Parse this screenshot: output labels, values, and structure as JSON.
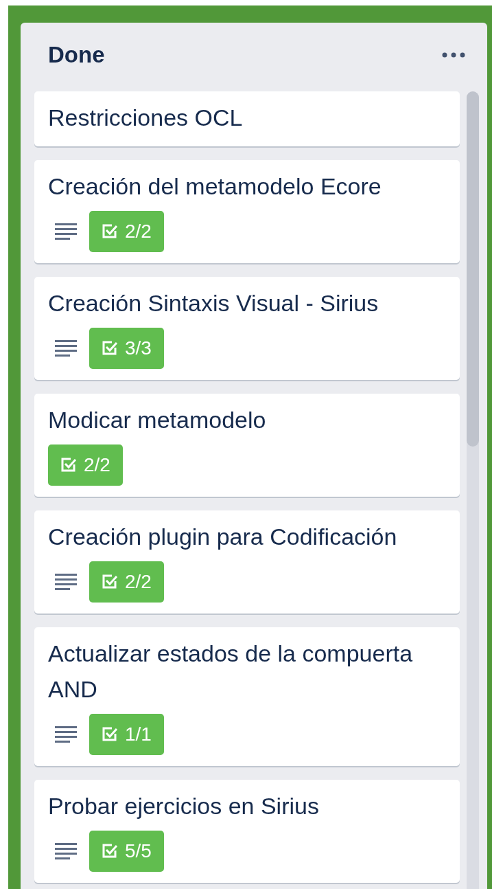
{
  "list": {
    "title": "Done",
    "cards": [
      {
        "title": "Restricciones OCL",
        "has_description": false
      },
      {
        "title": "Creación del metamodelo Ecore",
        "has_description": true,
        "checklist": {
          "count": "2/2",
          "complete": true
        }
      },
      {
        "title": "Creación Sintaxis Visual - Sirius",
        "has_description": true,
        "checklist": {
          "count": "3/3",
          "complete": true
        }
      },
      {
        "title": "Modicar metamodelo",
        "has_description": false,
        "checklist": {
          "count": "2/2",
          "complete": true
        }
      },
      {
        "title": "Creación plugin para Codificación",
        "has_description": true,
        "checklist": {
          "count": "2/2",
          "complete": true
        }
      },
      {
        "title": "Actualizar estados de la compuerta AND",
        "has_description": true,
        "checklist": {
          "count": "1/1",
          "complete": true
        }
      },
      {
        "title": "Probar ejercicios en Sirius",
        "has_description": true,
        "checklist": {
          "count": "5/5",
          "complete": true
        }
      }
    ]
  }
}
